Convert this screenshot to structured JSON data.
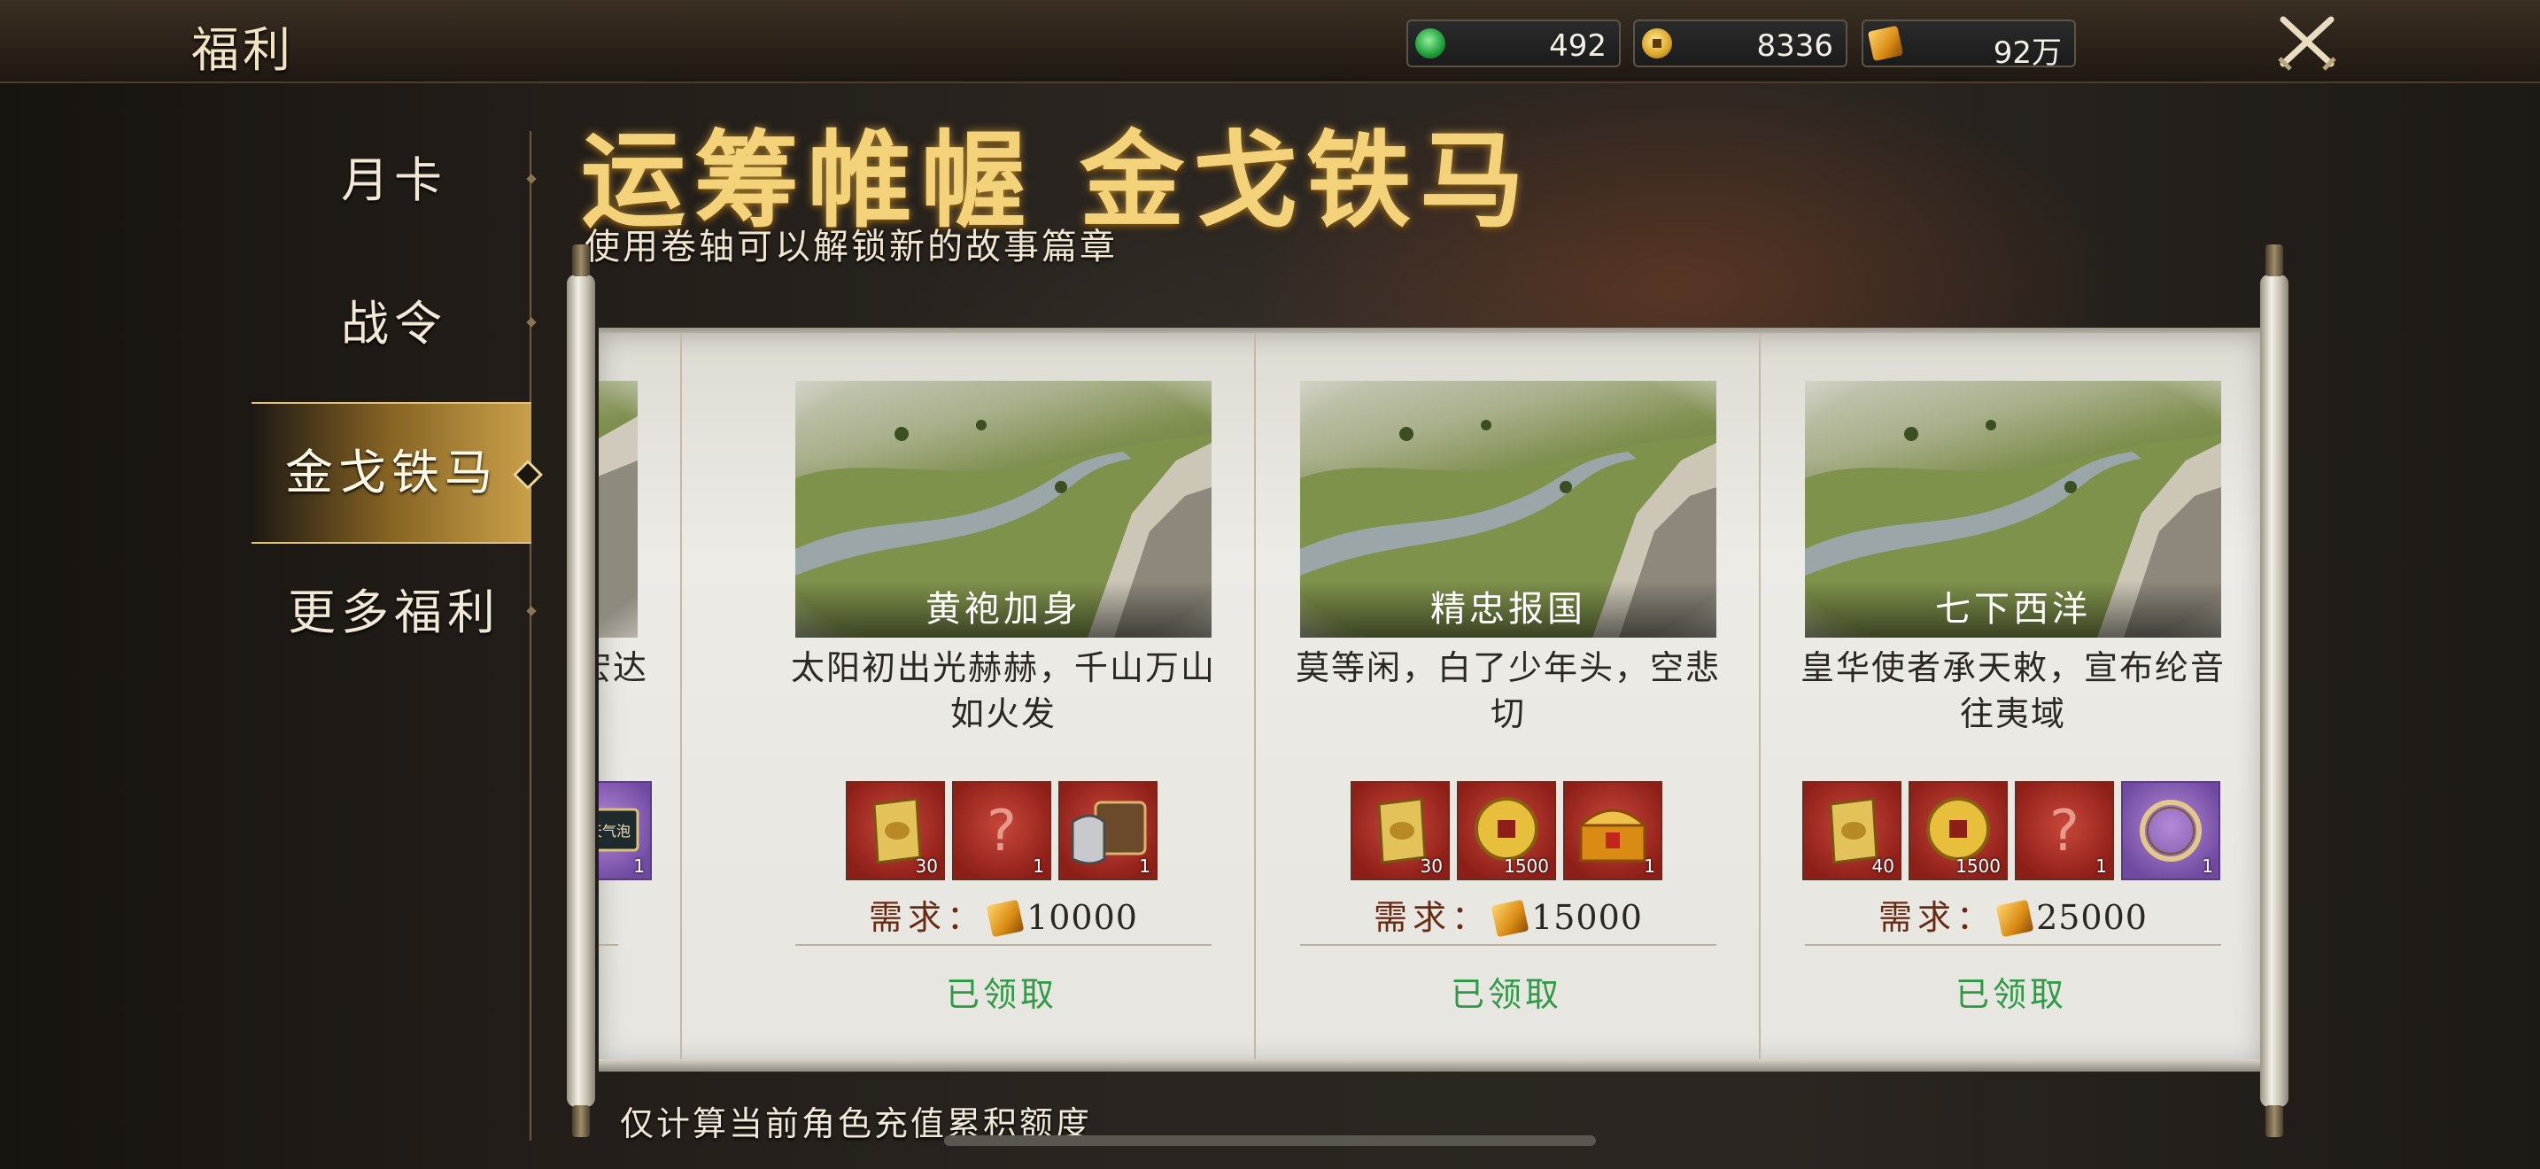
{
  "app_title": "福利",
  "resources": [
    {
      "icon": "jade-icon",
      "value": "492"
    },
    {
      "icon": "coin-icon",
      "value": "8336"
    },
    {
      "icon": "gold-ingot-icon",
      "value": "92万"
    }
  ],
  "sidebar": {
    "items": [
      {
        "label": "月卡",
        "active": false
      },
      {
        "label": "战令",
        "active": false
      },
      {
        "label": "金戈铁马",
        "active": true
      },
      {
        "label": "更多福利",
        "active": false
      }
    ]
  },
  "banner": {
    "title": "运筹帷幄 金戈铁马",
    "subtitle": "使用卷轴可以解锁新的故事篇章"
  },
  "partial_card": {
    "desc": "基宏达",
    "reward": {
      "icon": "chat-bubble-item-icon",
      "text": "聊天气泡",
      "count": "1",
      "color": "purple"
    }
  },
  "cards": [
    {
      "chapter": "黄袍加身",
      "desc": "太阳初出光赫赫，千山万山如火发",
      "rewards": [
        {
          "icon": "gold-token-icon",
          "count": "30",
          "color": "red"
        },
        {
          "icon": "mystery-icon",
          "count": "1",
          "color": "red"
        },
        {
          "icon": "armor-chest-icon",
          "count": "1",
          "color": "red"
        }
      ],
      "need_label": "需求：",
      "need_value": "10000",
      "status": "已领取"
    },
    {
      "chapter": "精忠报国",
      "desc": "莫等闲，白了少年头，空悲切",
      "rewards": [
        {
          "icon": "gold-token-icon",
          "count": "30",
          "color": "red"
        },
        {
          "icon": "coin-icon",
          "count": "1500",
          "color": "red"
        },
        {
          "icon": "golden-chest-icon",
          "count": "1",
          "color": "red"
        }
      ],
      "need_label": "需求：",
      "need_value": "15000",
      "status": "已领取"
    },
    {
      "chapter": "七下西洋",
      "desc": "皇华使者承天敕，宣布纶音往夷域",
      "rewards": [
        {
          "icon": "gold-token-icon",
          "count": "40",
          "color": "red"
        },
        {
          "icon": "coin-icon",
          "count": "1500",
          "color": "red"
        },
        {
          "icon": "mystery-icon",
          "count": "1",
          "color": "red"
        },
        {
          "icon": "ring-frame-icon",
          "count": "1",
          "color": "purple"
        }
      ],
      "need_label": "需求：",
      "need_value": "25000",
      "status": "已领取"
    }
  ],
  "footnote": "仅计算当前角色充值累积额度",
  "colors": {
    "accent_gold": "#f3d27a",
    "claimed_green": "#2f9a45",
    "reward_red": "#a8322a",
    "reward_purple": "#8c63bd"
  }
}
